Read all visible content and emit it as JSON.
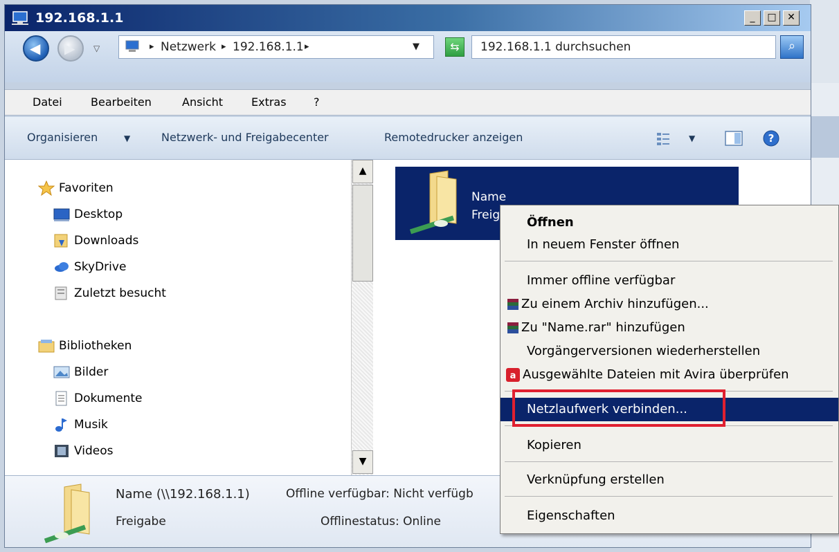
{
  "window": {
    "title": "192.168.1.1"
  },
  "title_buttons": {
    "minimize": "_",
    "maximize": "□",
    "close": "✕"
  },
  "address": {
    "crumbs": [
      "Netzwerk",
      "192.168.1.1"
    ],
    "search_placeholder": "192.168.1.1 durchsuchen"
  },
  "menu": [
    "Datei",
    "Bearbeiten",
    "Ansicht",
    "Extras",
    "?"
  ],
  "toolbar": {
    "organize": "Organisieren",
    "network_center": "Netzwerk- und Freigabecenter",
    "remote_printers": "Remotedrucker anzeigen"
  },
  "nav": {
    "favorites_header": "Favoriten",
    "favorites": [
      "Desktop",
      "Downloads",
      "SkyDrive",
      "Zuletzt besucht"
    ],
    "libraries_header": "Bibliotheken",
    "libraries": [
      "Bilder",
      "Dokumente",
      "Musik",
      "Videos"
    ]
  },
  "selected_item": {
    "name": "Name",
    "type": "Freigabe"
  },
  "details": {
    "name_path": "Name (\\\\192.168.1.1)",
    "offline_available": "Offline verfügbar: Nicht verfügb",
    "type": "Freigabe",
    "offline_status": "Offlinestatus: Online"
  },
  "context_menu": {
    "open": "Öffnen",
    "open_new_window": "In neuem Fenster öffnen",
    "always_offline": "Immer offline verfügbar",
    "add_archive": "Zu einem Archiv hinzufügen...",
    "add_rar": "Zu \"Name.rar\" hinzufügen",
    "restore_versions": "Vorgängerversionen wiederherstellen",
    "avira_scan": "Ausgewählte Dateien mit Avira überprüfen",
    "map_drive": "Netzlaufwerk verbinden...",
    "copy": "Kopieren",
    "create_shortcut": "Verknüpfung erstellen",
    "properties": "Eigenschaften"
  },
  "colors": {
    "selection": "#0a246a",
    "highlight_box": "#e02030"
  }
}
